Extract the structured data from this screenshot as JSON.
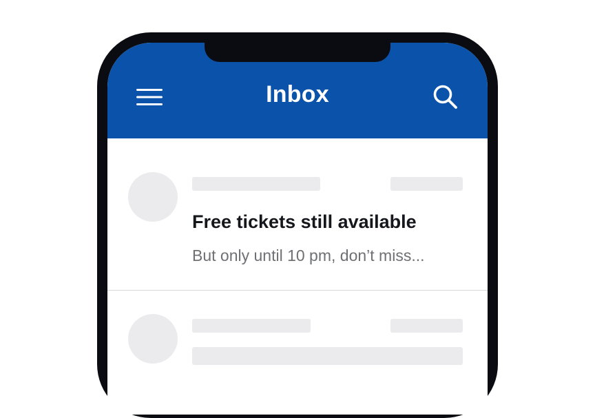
{
  "header": {
    "title": "Inbox",
    "background_color": "#0b53aa",
    "menu_icon": "hamburger-menu-icon",
    "search_icon": "search-icon"
  },
  "messages": [
    {
      "subject": "Free tickets still available",
      "preview": "But only until 10 pm, don’t miss..."
    }
  ]
}
